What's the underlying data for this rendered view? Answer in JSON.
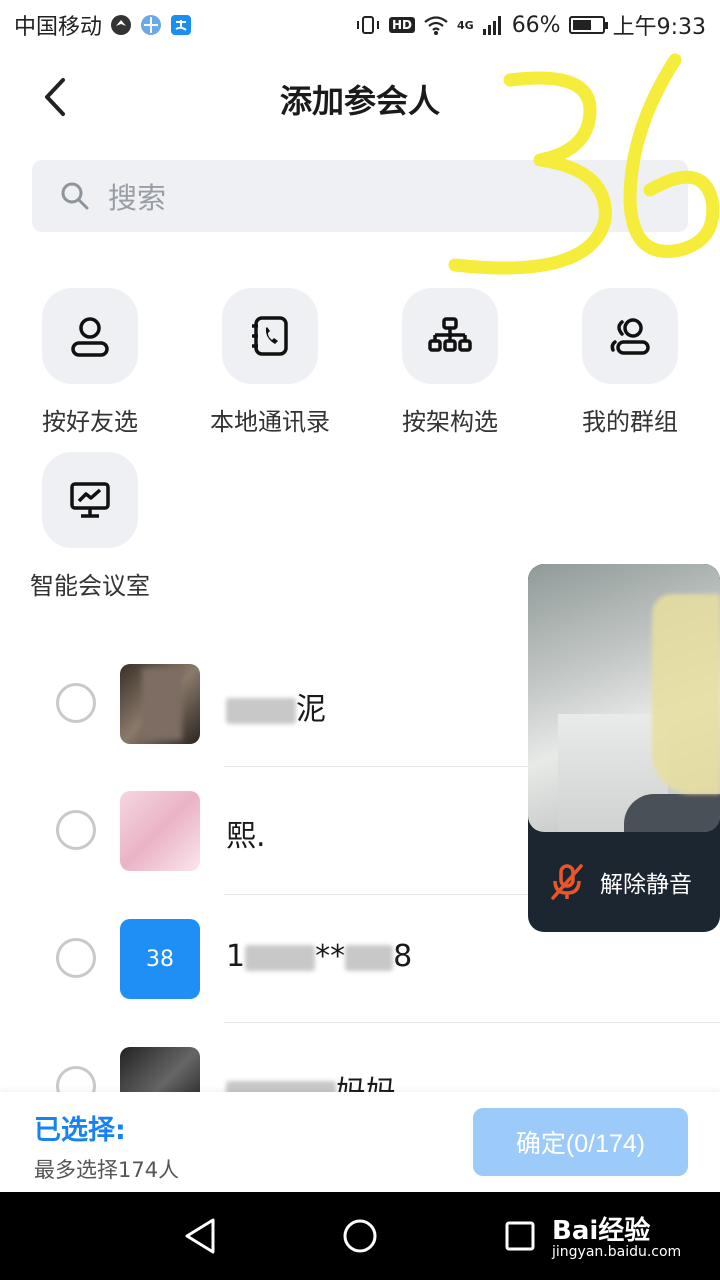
{
  "status_bar": {
    "carrier": "中国移动",
    "hd": "HD",
    "network": "4G",
    "battery_text": "66%",
    "battery_level": 0.66,
    "time": "上午9:33"
  },
  "header": {
    "title": "添加参会人"
  },
  "search": {
    "placeholder": "搜索",
    "icon": "search-icon"
  },
  "options": [
    {
      "label": "按好友选",
      "icon": "person-icon"
    },
    {
      "label": "本地通讯录",
      "icon": "phonebook-icon"
    },
    {
      "label": "按架构选",
      "icon": "org-chart-icon"
    },
    {
      "label": "我的群组",
      "icon": "group-icon"
    },
    {
      "label": "智能会议室",
      "icon": "meeting-room-icon"
    }
  ],
  "contacts": [
    {
      "name_visible": "泥",
      "checked": false
    },
    {
      "name_visible": "熙.",
      "checked": false
    },
    {
      "name_visible": "1",
      "name_mid": "**",
      "name_tail": "8",
      "avatar_text": "38",
      "checked": false
    },
    {
      "name_visible": "妈妈",
      "checked": false
    }
  ],
  "video": {
    "unmute_label": "解除静音",
    "icon": "mic-muted-icon",
    "accent": "#e8562a"
  },
  "bottom": {
    "selected_label": "已选择:",
    "max_label": "最多选择174人",
    "confirm_label": "确定(0/174)"
  },
  "nav": {
    "back": "nav-back-icon",
    "home": "nav-home-icon",
    "recents": "nav-recents-icon"
  },
  "overlay": {
    "scribble_text": "36",
    "watermark": "Bai经验",
    "watermark_url": "jingyan.baidu.com"
  },
  "colors": {
    "accent_blue": "#1783f2",
    "confirm_disabled": "#9ccbfa",
    "search_bg": "#eef0f3"
  }
}
